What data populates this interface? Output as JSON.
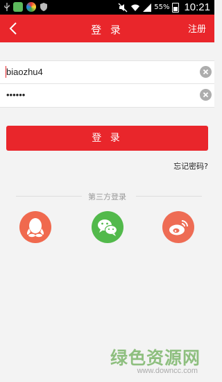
{
  "status_bar": {
    "battery_text": "55%",
    "time": "10:21",
    "icons": [
      "usb-icon",
      "app-icon-green",
      "app-icon-color",
      "shield-icon",
      "mute-icon",
      "wifi-icon",
      "signal-icon",
      "battery-icon"
    ]
  },
  "header": {
    "title": "登 录",
    "register_label": "注册",
    "color": "#e9262b"
  },
  "form": {
    "username_value": "biaozhu4",
    "password_value": "••••••"
  },
  "login_button_label": "登 录",
  "forgot_password_label": "忘记密码?",
  "third_party": {
    "label": "第三方登录",
    "providers": [
      {
        "name": "QQ",
        "icon": "qq-icon",
        "color": "#f0694e"
      },
      {
        "name": "WeChat",
        "icon": "wechat-icon",
        "color": "#52b94b"
      },
      {
        "name": "Weibo",
        "icon": "weibo-icon",
        "color": "#ee6c54"
      }
    ]
  },
  "watermark": {
    "text": "绿色资源网",
    "url": "www.downcc.com"
  }
}
